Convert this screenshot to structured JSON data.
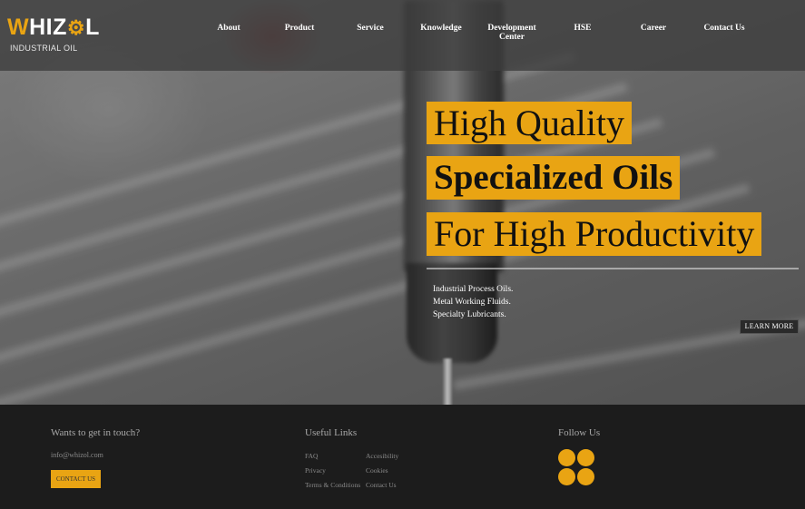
{
  "brand": {
    "logo_text": "WHIZOL",
    "logo_subtitle": "INDUSTRIAL OIL",
    "accent_color": "#e9a413"
  },
  "nav": {
    "items": [
      {
        "label": "About"
      },
      {
        "label": "Product"
      },
      {
        "label": "Service"
      },
      {
        "label": "Knowledge"
      },
      {
        "label": "Development Center"
      },
      {
        "label": "HSE"
      },
      {
        "label": "Career"
      },
      {
        "label": "Contact Us"
      }
    ]
  },
  "hero": {
    "headline_1": "High Quality",
    "headline_2": "Specialized Oils",
    "headline_3": "For High Productivity",
    "bullets": [
      "Industrial Process Oils.",
      "Metal Working Fluids.",
      "Specialty Lubricants."
    ],
    "cta_label": "LEARN MORE"
  },
  "footer": {
    "contact": {
      "title": "Wants to get in touch?",
      "email": "info@whizol.com",
      "button_label": "CONTACT US"
    },
    "useful_links": {
      "title": "Useful Links",
      "col1": [
        "FAQ",
        "Privacy",
        "Terms & Conditions"
      ],
      "col2": [
        "Accesibility",
        "Cookies",
        "Contact Us"
      ]
    },
    "follow": {
      "title": "Follow Us",
      "icons": [
        "social-icon-1",
        "social-icon-2",
        "social-icon-3",
        "social-icon-4"
      ]
    }
  }
}
